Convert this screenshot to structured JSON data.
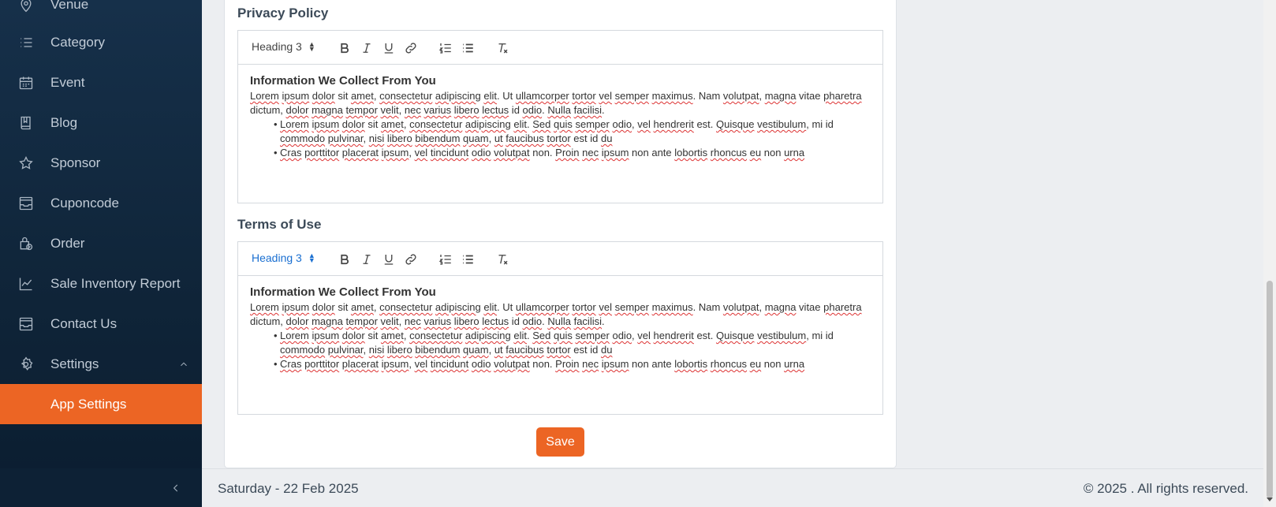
{
  "sidebar": {
    "items": [
      {
        "label": "Venue",
        "icon": "location-pin-icon"
      },
      {
        "label": "Category",
        "icon": "list-icon"
      },
      {
        "label": "Event",
        "icon": "calendar-icon"
      },
      {
        "label": "Blog",
        "icon": "book-icon"
      },
      {
        "label": "Sponsor",
        "icon": "star-icon"
      },
      {
        "label": "Cuponcode",
        "icon": "inbox-icon"
      },
      {
        "label": "Order",
        "icon": "shopping-bag-icon"
      },
      {
        "label": "Sale Inventory Report",
        "icon": "line-chart-icon"
      },
      {
        "label": "Contact Us",
        "icon": "inbox-icon"
      },
      {
        "label": "Settings",
        "icon": "gear-icon"
      },
      {
        "label": "App Settings",
        "icon": ""
      }
    ]
  },
  "privacy": {
    "title": "Privacy Policy",
    "format": "Heading 3",
    "heading": "Information We Collect From You",
    "p1": [
      {
        "t": "Lorem",
        "s": 1
      },
      {
        "t": " ",
        "s": 0
      },
      {
        "t": "ipsum",
        "s": 1
      },
      {
        "t": " ",
        "s": 0
      },
      {
        "t": "dolor",
        "s": 1
      },
      {
        "t": " sit ",
        "s": 0
      },
      {
        "t": "amet",
        "s": 1
      },
      {
        "t": ", ",
        "s": 0
      },
      {
        "t": "consectetur",
        "s": 1
      },
      {
        "t": " ",
        "s": 0
      },
      {
        "t": "adipiscing",
        "s": 1
      },
      {
        "t": " ",
        "s": 0
      },
      {
        "t": "elit",
        "s": 1
      },
      {
        "t": ". Ut ",
        "s": 0
      },
      {
        "t": "ullamcorper",
        "s": 1
      },
      {
        "t": " ",
        "s": 0
      },
      {
        "t": "tortor",
        "s": 1
      },
      {
        "t": " ",
        "s": 0
      },
      {
        "t": "vel",
        "s": 1
      },
      {
        "t": " ",
        "s": 0
      },
      {
        "t": "semper",
        "s": 1
      },
      {
        "t": " ",
        "s": 0
      },
      {
        "t": "maximus",
        "s": 1
      },
      {
        "t": ". Nam ",
        "s": 0
      },
      {
        "t": "volutpat",
        "s": 1
      },
      {
        "t": ", ",
        "s": 0
      },
      {
        "t": "magna",
        "s": 1
      },
      {
        "t": " vitae ",
        "s": 0
      },
      {
        "t": "pharetra",
        "s": 1
      },
      {
        "t": " dictum, ",
        "s": 0
      },
      {
        "t": "dolor",
        "s": 1
      },
      {
        "t": " ",
        "s": 0
      },
      {
        "t": "magna",
        "s": 1
      },
      {
        "t": " ",
        "s": 0
      },
      {
        "t": "tempor",
        "s": 1
      },
      {
        "t": " ",
        "s": 0
      },
      {
        "t": "velit",
        "s": 1
      },
      {
        "t": ", ",
        "s": 0
      },
      {
        "t": "nec",
        "s": 1
      },
      {
        "t": " ",
        "s": 0
      },
      {
        "t": "varius",
        "s": 1
      },
      {
        "t": " ",
        "s": 0
      },
      {
        "t": "libero",
        "s": 1
      },
      {
        "t": " ",
        "s": 0
      },
      {
        "t": "lectus",
        "s": 1
      },
      {
        "t": " id ",
        "s": 0
      },
      {
        "t": "odio",
        "s": 1
      },
      {
        "t": ". ",
        "s": 0
      },
      {
        "t": "Nulla",
        "s": 1
      },
      {
        "t": " ",
        "s": 0
      },
      {
        "t": "facilisi",
        "s": 1
      },
      {
        "t": ".",
        "s": 0
      }
    ],
    "li1": [
      {
        "t": "Lorem",
        "s": 1
      },
      {
        "t": " ",
        "s": 0
      },
      {
        "t": "ipsum",
        "s": 1
      },
      {
        "t": " ",
        "s": 0
      },
      {
        "t": "dolor",
        "s": 1
      },
      {
        "t": " sit ",
        "s": 0
      },
      {
        "t": "amet",
        "s": 1
      },
      {
        "t": ", ",
        "s": 0
      },
      {
        "t": "consectetur",
        "s": 1
      },
      {
        "t": " ",
        "s": 0
      },
      {
        "t": "adipiscing",
        "s": 1
      },
      {
        "t": " ",
        "s": 0
      },
      {
        "t": "elit",
        "s": 1
      },
      {
        "t": ". ",
        "s": 0
      },
      {
        "t": "Sed",
        "s": 1
      },
      {
        "t": " ",
        "s": 0
      },
      {
        "t": "quis",
        "s": 1
      },
      {
        "t": " ",
        "s": 0
      },
      {
        "t": "semper",
        "s": 1
      },
      {
        "t": " ",
        "s": 0
      },
      {
        "t": "odio",
        "s": 1
      },
      {
        "t": ", ",
        "s": 0
      },
      {
        "t": "vel",
        "s": 1
      },
      {
        "t": " ",
        "s": 0
      },
      {
        "t": "hendrerit",
        "s": 1
      },
      {
        "t": " est. ",
        "s": 0
      },
      {
        "t": "Quisque",
        "s": 1
      },
      {
        "t": " ",
        "s": 0
      },
      {
        "t": "vestibulum",
        "s": 1
      },
      {
        "t": ", mi id ",
        "s": 0
      },
      {
        "t": "commodo",
        "s": 1
      },
      {
        "t": " ",
        "s": 0
      },
      {
        "t": "pulvinar",
        "s": 1
      },
      {
        "t": ", ",
        "s": 0
      },
      {
        "t": "nisi",
        "s": 1
      },
      {
        "t": " ",
        "s": 0
      },
      {
        "t": "libero",
        "s": 1
      },
      {
        "t": " ",
        "s": 0
      },
      {
        "t": "bibendum",
        "s": 1
      },
      {
        "t": " ",
        "s": 0
      },
      {
        "t": "quam",
        "s": 1
      },
      {
        "t": ", ",
        "s": 0
      },
      {
        "t": "ut",
        "s": 1
      },
      {
        "t": " ",
        "s": 0
      },
      {
        "t": "faucibus",
        "s": 1
      },
      {
        "t": " ",
        "s": 0
      },
      {
        "t": "tortor",
        "s": 1
      },
      {
        "t": " est id ",
        "s": 0
      },
      {
        "t": "du",
        "s": 1
      }
    ],
    "li2": [
      {
        "t": "Cras",
        "s": 1
      },
      {
        "t": " ",
        "s": 0
      },
      {
        "t": "porttitor",
        "s": 1
      },
      {
        "t": " ",
        "s": 0
      },
      {
        "t": "placerat",
        "s": 1
      },
      {
        "t": " ",
        "s": 0
      },
      {
        "t": "ipsum",
        "s": 1
      },
      {
        "t": ", ",
        "s": 0
      },
      {
        "t": "vel",
        "s": 1
      },
      {
        "t": " ",
        "s": 0
      },
      {
        "t": "tincidunt",
        "s": 1
      },
      {
        "t": " ",
        "s": 0
      },
      {
        "t": "odio",
        "s": 1
      },
      {
        "t": " ",
        "s": 0
      },
      {
        "t": "volutpat",
        "s": 1
      },
      {
        "t": " non. ",
        "s": 0
      },
      {
        "t": "Proin",
        "s": 1
      },
      {
        "t": " ",
        "s": 0
      },
      {
        "t": "nec",
        "s": 1
      },
      {
        "t": " ",
        "s": 0
      },
      {
        "t": "ipsum",
        "s": 1
      },
      {
        "t": " non ante ",
        "s": 0
      },
      {
        "t": "lobortis",
        "s": 1
      },
      {
        "t": " ",
        "s": 0
      },
      {
        "t": "rhoncus",
        "s": 1
      },
      {
        "t": " ",
        "s": 0
      },
      {
        "t": "eu",
        "s": 1
      },
      {
        "t": " non ",
        "s": 0
      },
      {
        "t": "urna",
        "s": 1
      }
    ]
  },
  "terms": {
    "title": "Terms of Use",
    "format": "Heading 3",
    "heading": "Information We Collect From You"
  },
  "save_label": "Save",
  "footer": {
    "date": "Saturday - 22 Feb 2025",
    "copyright": "© 2025 . All rights reserved."
  },
  "colors": {
    "accent": "#ec6524",
    "sidebar": "#12283e",
    "link_blue": "#1a6fd1"
  }
}
